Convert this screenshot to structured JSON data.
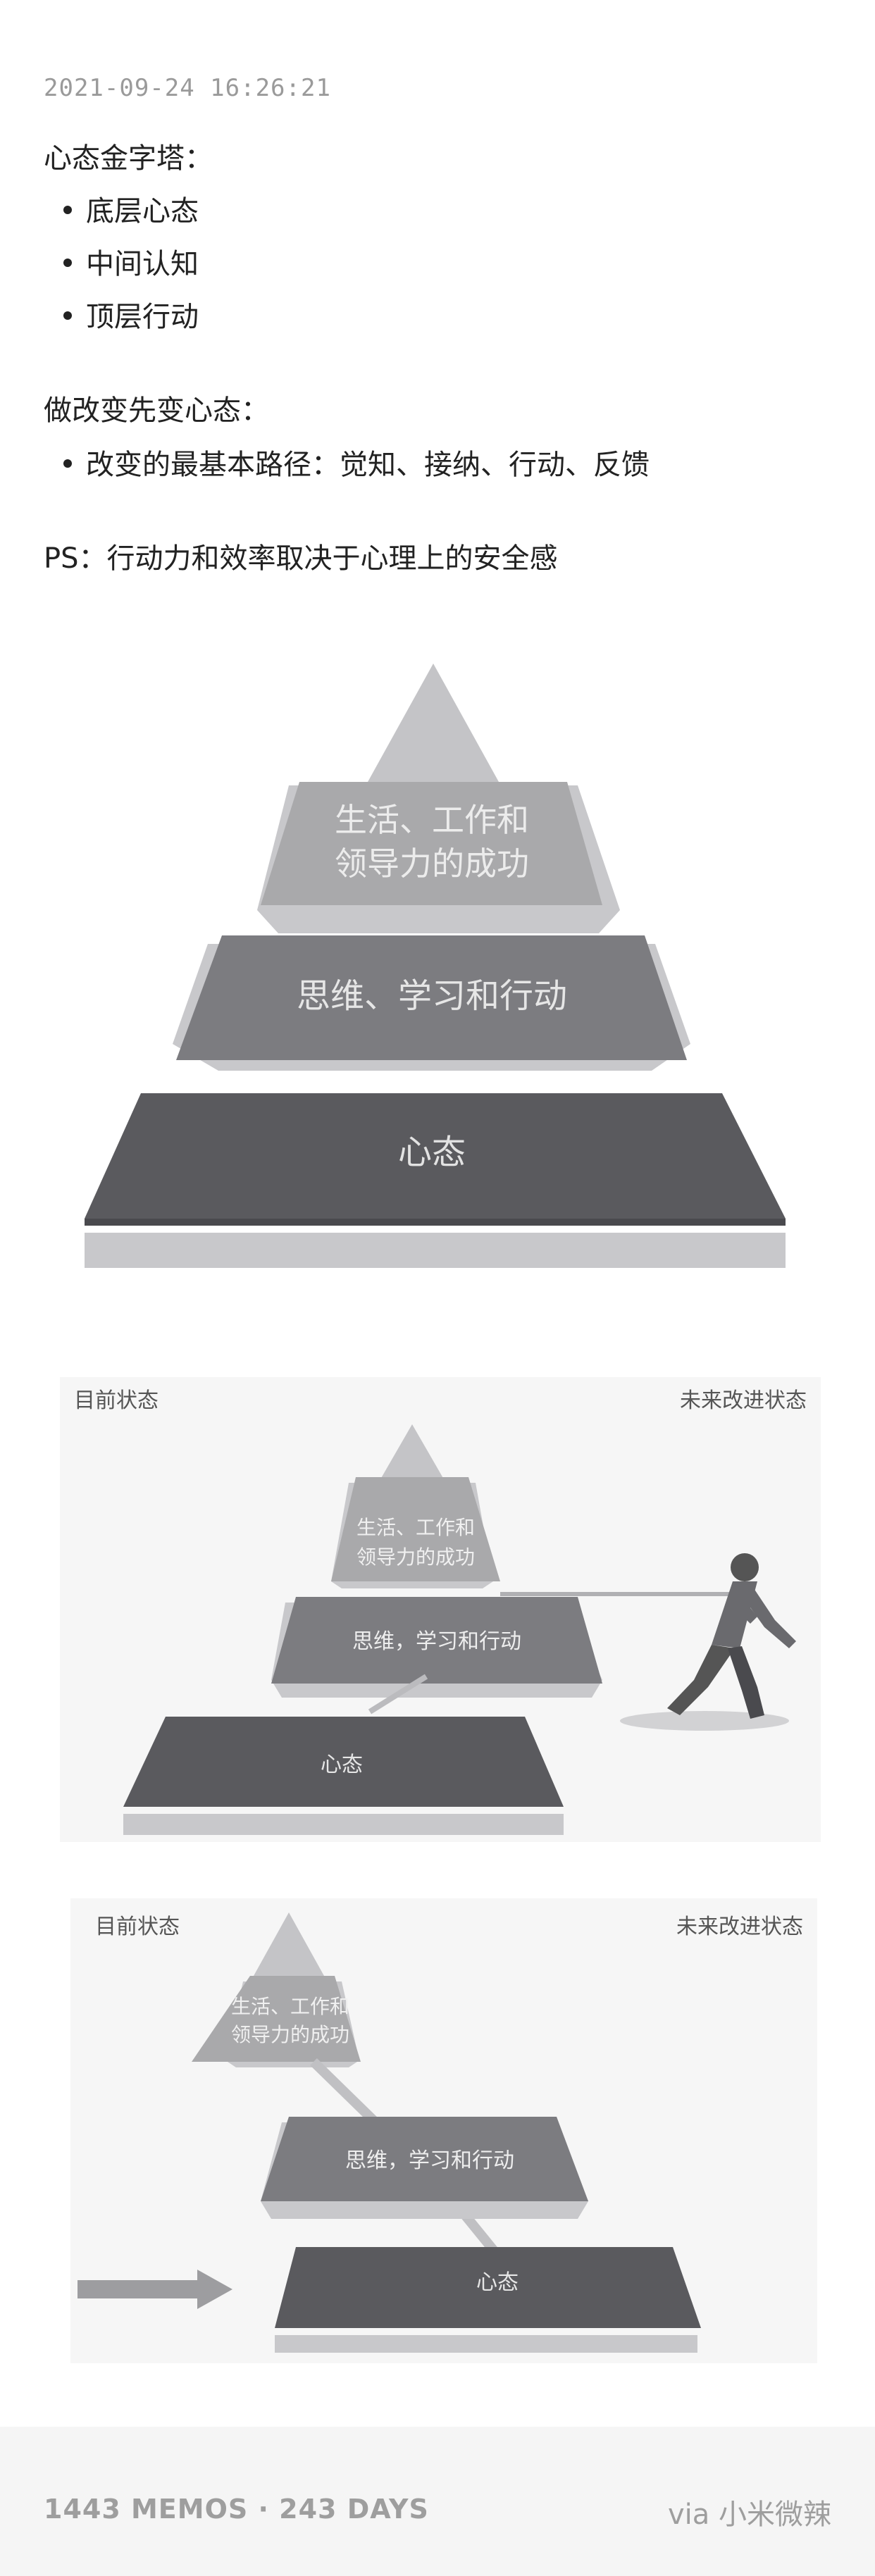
{
  "memo": {
    "timestamp": "2021-09-24 16:26:21",
    "section1_title": "心态金字塔：",
    "section1_items": [
      "底层心态",
      "中间认知",
      "顶层行动"
    ],
    "section2_title": "做改变先变心态：",
    "section2_items": [
      "改变的最基本路径：觉知、接纳、行动、反馈"
    ],
    "ps": "PS：行动力和效率取决于心理上的安全感"
  },
  "figure1": {
    "top_line1": "生活、工作和",
    "top_line2": "领导力的成功",
    "middle": "思维、学习和行动",
    "bottom": "心态"
  },
  "figure2": {
    "left_label": "目前状态",
    "right_label": "未来改进状态",
    "top_line1": "生活、工作和",
    "top_line2": "领导力的成功",
    "middle": "思维，学习和行动",
    "bottom": "心态"
  },
  "figure3": {
    "left_label": "目前状态",
    "right_label": "未来改进状态",
    "top_line1": "生活、工作和",
    "top_line2": "领导力的成功",
    "middle": "思维，学习和行动",
    "bottom": "心态"
  },
  "footer": {
    "stats": "1443 MEMOS · 243 DAYS",
    "via": "via 小米微辣"
  },
  "colors": {
    "tier_light": "#a9a9ab",
    "tier_mid": "#7c7c80",
    "tier_dark": "#5a5a5e",
    "slab": "#c8c8cb",
    "footer_bg": "#f5f5f5"
  }
}
